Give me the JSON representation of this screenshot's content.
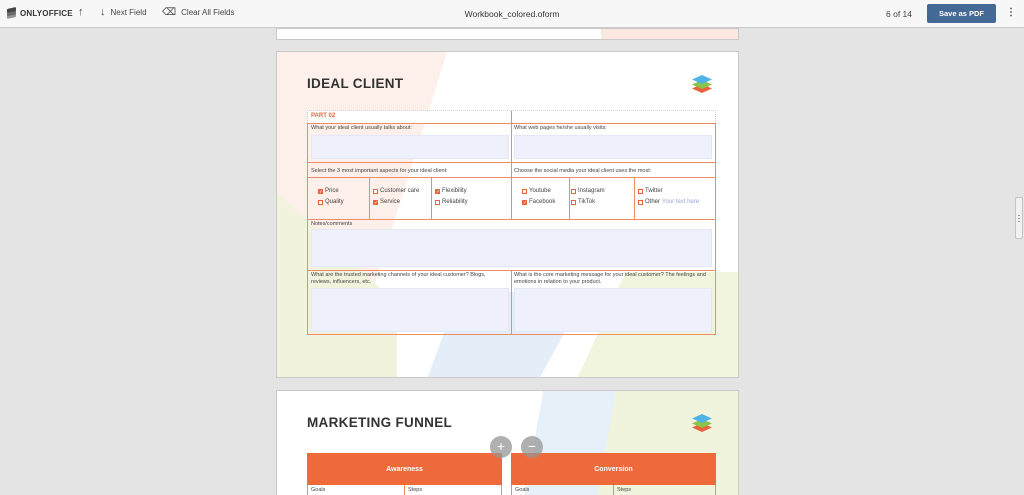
{
  "toolbar": {
    "logo_text": "ONLYOFFICE",
    "prev_field_icon": "arrow-up-icon",
    "next_field_label": "Next Field",
    "clear_fields_label": "Clear All Fields",
    "document_title": "Workbook_colored.oform",
    "page_counter": "6 of 14",
    "save_pdf_label": "Save as PDF",
    "more_icon": "⋮"
  },
  "page_ideal_client": {
    "title": "IDEAL CLIENT",
    "part_label": "PART 02",
    "q_talks_about": "What your ideal client usually talks about:",
    "q_web_pages": "What web pages he/she usually visits:",
    "q_aspects": "Select the 3 most important aspects for your ideal client:",
    "q_social_media": "Choose the social media your ideal client uses the most:",
    "aspects": [
      {
        "label": "Price",
        "checked": true
      },
      {
        "label": "Quality",
        "checked": false
      },
      {
        "label": "Customer care",
        "checked": false
      },
      {
        "label": "Service",
        "checked": true
      },
      {
        "label": "Flexibility",
        "checked": true
      },
      {
        "label": "Reliability",
        "checked": false
      }
    ],
    "social": [
      {
        "label": "Youtube",
        "checked": false
      },
      {
        "label": "Facebook",
        "checked": true
      },
      {
        "label": "Instagram",
        "checked": false
      },
      {
        "label": "TikTok",
        "checked": false
      },
      {
        "label": "Twitter",
        "checked": false
      },
      {
        "label": "Other",
        "checked": false
      }
    ],
    "other_placeholder": "Your text here",
    "notes_label": "Notes/comments",
    "q_channels": "What are the trusted marketing channels of your ideal customer? Blogs, reviews, influencers, etc.",
    "q_core_message": "What is the core marketing message for your ideal customer? The feelings and emotions in relation to your product."
  },
  "page_funnel": {
    "title": "MARKETING FUNNEL",
    "zoom_in": "+",
    "zoom_out": "−",
    "stages": [
      {
        "label": "Awareness",
        "col1": "Goals",
        "col2": "Steps"
      },
      {
        "label": "Conversion",
        "col1": "Goals",
        "col2": "Steps"
      }
    ]
  },
  "colors": {
    "accent_orange": "#e8633b",
    "save_button": "#446995",
    "field_fill": "#eef0fb"
  }
}
